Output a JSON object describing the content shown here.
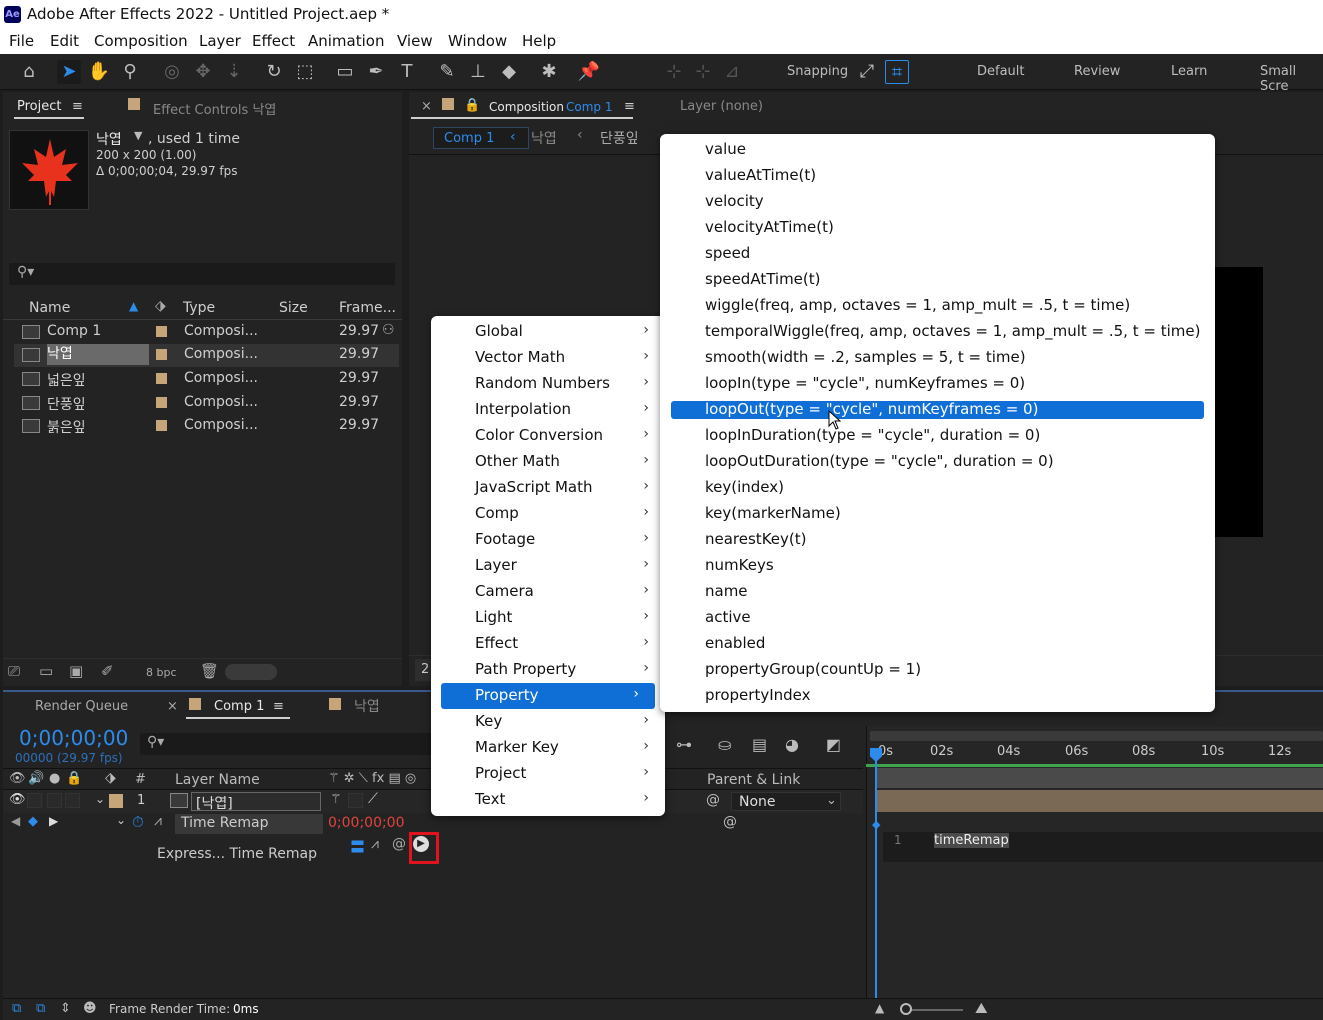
{
  "window": {
    "title": "Adobe After Effects 2022 - Untitled Project.aep *",
    "logo": "Ae"
  },
  "menubar": [
    "File",
    "Edit",
    "Composition",
    "Layer",
    "Effect",
    "Animation",
    "View",
    "Window",
    "Help"
  ],
  "toolbar": {
    "snapping": "Snapping",
    "workspaces": [
      "Default",
      "Review",
      "Learn",
      "Small Scre"
    ]
  },
  "project_panel": {
    "tab": "Project",
    "effect_controls_tab": "Effect Controls 낙엽",
    "preview": {
      "name": "낙엽",
      "used": ", used 1 time",
      "dims": "200 x 200 (1.00)",
      "duration": "Δ 0;00;00;04, 29.97 fps"
    },
    "columns": {
      "name": "Name",
      "type": "Type",
      "size": "Size",
      "frame": "Frame..."
    },
    "items": [
      {
        "name": "Comp 1",
        "type": "Composi...",
        "frame": "29.97"
      },
      {
        "name": "낙엽",
        "type": "Composi...",
        "frame": "29.97"
      },
      {
        "name": "넓은잎",
        "type": "Composi...",
        "frame": "29.97"
      },
      {
        "name": "단풍잎",
        "type": "Composi...",
        "frame": "29.97"
      },
      {
        "name": "붉은잎",
        "type": "Composi...",
        "frame": "29.97"
      }
    ],
    "bpc": "8 bpc"
  },
  "comp_panel": {
    "tab_prefix": "Composition",
    "tab_name": "Comp 1",
    "layer_tab": "Layer (none)",
    "breadcrumbs": [
      "Comp 1",
      "낙엽",
      "단풍잎"
    ],
    "zoom_partial": "2"
  },
  "timeline": {
    "render_queue": "Render Queue",
    "comp_tab": "Comp 1",
    "other_tab": "낙엽",
    "timecode": "0;00;00;00",
    "frames": "00000 (29.97 fps)",
    "layer_name_header": "Layer Name",
    "num_header": "#",
    "parent_header": "Parent & Link",
    "layer": {
      "num": "1",
      "name": "[낙엽]",
      "parent": "None"
    },
    "time_remap": {
      "label": "Time Remap",
      "value": "0;00;00;00"
    },
    "expression": {
      "label": "Express... Time Remap",
      "code": "timeRemap",
      "line": "1"
    },
    "ruler": [
      "0s",
      "02s",
      "04s",
      "06s",
      "08s",
      "10s",
      "12s"
    ],
    "frame_render": "Frame Render Time:",
    "frame_render_value": "0ms"
  },
  "context_menu": {
    "items": [
      "Global",
      "Vector Math",
      "Random Numbers",
      "Interpolation",
      "Color Conversion",
      "Other Math",
      "JavaScript Math",
      "Comp",
      "Footage",
      "Layer",
      "Camera",
      "Light",
      "Effect",
      "Path Property",
      "Property",
      "Key",
      "Marker Key",
      "Project",
      "Text"
    ],
    "selected": "Property"
  },
  "submenu": {
    "items": [
      "value",
      "valueAtTime(t)",
      "velocity",
      "velocityAtTime(t)",
      "speed",
      "speedAtTime(t)",
      "wiggle(freq, amp, octaves = 1, amp_mult = .5, t = time)",
      "temporalWiggle(freq, amp, octaves = 1, amp_mult = .5, t = time)",
      "smooth(width = .2, samples = 5, t = time)",
      "loopIn(type = \"cycle\", numKeyframes = 0)",
      "loopOut(type = \"cycle\", numKeyframes = 0)",
      "loopInDuration(type = \"cycle\", duration = 0)",
      "loopOutDuration(type = \"cycle\", duration = 0)",
      "key(index)",
      "key(markerName)",
      "nearestKey(t)",
      "numKeys",
      "name",
      "active",
      "enabled",
      "propertyGroup(countUp = 1)",
      "propertyIndex"
    ],
    "selected": "loopOut(type = \"cycle\", numKeyframes = 0)"
  },
  "colors": {
    "accent": "#2d8ceb",
    "selection": "#0f6fd6",
    "timecode_red": "#e0443a",
    "highlight_box": "#e0141e"
  }
}
